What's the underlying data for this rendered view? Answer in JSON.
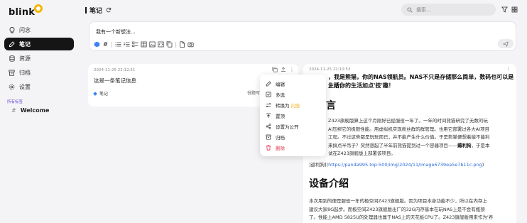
{
  "app": {
    "logo_text": "blink"
  },
  "sidebar": {
    "items": [
      {
        "label": "闪念",
        "icon": "lightbulb-icon",
        "active": false
      },
      {
        "label": "笔记",
        "icon": "note-icon",
        "active": true
      },
      {
        "label": "资源",
        "icon": "database-icon",
        "active": false
      },
      {
        "label": "归档",
        "icon": "archive-icon",
        "active": false
      },
      {
        "label": "设置",
        "icon": "gear-icon",
        "active": false
      }
    ],
    "tags_heading": "所有标签",
    "tags": [
      {
        "label": "Welcome",
        "icon": "hash-icon"
      }
    ]
  },
  "header": {
    "title": "笔记",
    "refresh_icon": "refresh-icon"
  },
  "search": {
    "placeholder": "搜索..."
  },
  "editor": {
    "text": "我有一个新想法...",
    "send_icon": "send-icon"
  },
  "memos": [
    {
      "date": "2024-11-25 22:12:51",
      "content": "这是一条笔记信息",
      "tag": "笔记",
      "extra": "份题写"
    },
    {
      "date": "2024-11-25 22:10:53",
      "intro_line1": "，我是熊猫，你的NAS领航员。NAS不只是存储那么简单，数码也可以是生活，",
      "intro_line2": "，给你的生活加点'技'趣！",
      "heading1": "言",
      "para1_line1": "Z423旗舰版算上这个月刚好已经服役一年了。一年的时间熊猫研究了无数的玩",
      "para1_line2": "Al压榨它的极限性能。用虚拟机实现粉丝群的群管理。也用它部署过各大AI项目",
      "para1_line3": "工程。不过这些都是玩玩而已，并不能产生什么价值。于是熊猫便想着能不能利",
      "para1_line4_pre": "来搞点半吊子？突然想起了半年前熊猫提到过一个容器项目——",
      "para1_line4_bold": "薅利狗",
      "para1_line4_post": "，于是本",
      "para1_line5": "试在Z423旗舰版上部署该项目。",
      "link_prefix": "]返利狗](",
      "link_url": "https://panda995.top:500/img/2024/11/image6739ea5e7b11c.png",
      "link_suffix": ")",
      "heading2": "设备介绍",
      "para2_line1": "本次用到的便是服役一年的极空间Z423旗舰版。因为项目本身功能不少，所以在内存上",
      "para2_line2": "建议大家8G起步。而极空间Z423旗舰版出厂的32G内存基本在玩NAS上是不会有瓶颈",
      "para2_line3": "了。性能上AMD 5825U的处理器也属于NAS上的天花板CPU了。Z423旗舰版用来作为'养"
    }
  ],
  "context_menu": {
    "items": [
      {
        "label": "编辑",
        "icon": "edit-icon"
      },
      {
        "label": "多选",
        "icon": "multi-select-icon"
      },
      {
        "label": "转换为",
        "highlight": "闪念",
        "icon": "convert-icon"
      },
      {
        "label": "置顶",
        "icon": "pin-icon"
      },
      {
        "label": "设置为公开",
        "icon": "share-icon"
      },
      {
        "label": "归档",
        "icon": "archive-icon"
      },
      {
        "label": "删除",
        "icon": "trash-icon",
        "danger": true
      }
    ]
  },
  "colors": {
    "accent": "#f6b500",
    "active_nav": "#151515",
    "danger": "#e0324a",
    "link": "#2b6cd9",
    "tag_purple": "#6e4bd8"
  }
}
